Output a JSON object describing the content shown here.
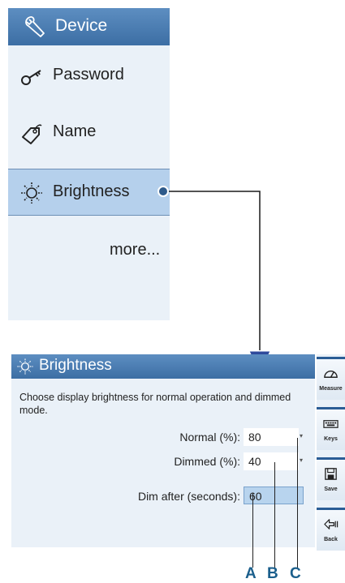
{
  "menu": {
    "header_title": "Device",
    "items": [
      {
        "label": "Password",
        "icon": "key-icon"
      },
      {
        "label": "Name",
        "icon": "tag-icon"
      },
      {
        "label": "Brightness",
        "icon": "sun-icon"
      }
    ],
    "more_label": "more..."
  },
  "screen": {
    "title": "Brightness",
    "description": "Choose display brightness for normal operation and dimmed mode.",
    "normal_label": "Normal (%):",
    "normal_value": "80",
    "dimmed_label": "Dimmed (%):",
    "dimmed_value": "40",
    "dim_after_label": "Dim after (seconds):",
    "dim_after_value": "60"
  },
  "sidebar": {
    "buttons": [
      {
        "label": "Measure",
        "icon": "gauge-icon"
      },
      {
        "label": "Keys",
        "icon": "keyboard-icon"
      },
      {
        "label": "Save",
        "icon": "floppy-disk-icon"
      },
      {
        "label": "Back",
        "icon": "back-arrow-icon"
      }
    ]
  },
  "callouts": [
    "A",
    "B",
    "C"
  ],
  "colors": {
    "header_blue": "#3c6ea4",
    "panel_bg": "#eaf1f8",
    "highlight": "#b5d0ec",
    "callout_blue": "#1b5f8c"
  }
}
